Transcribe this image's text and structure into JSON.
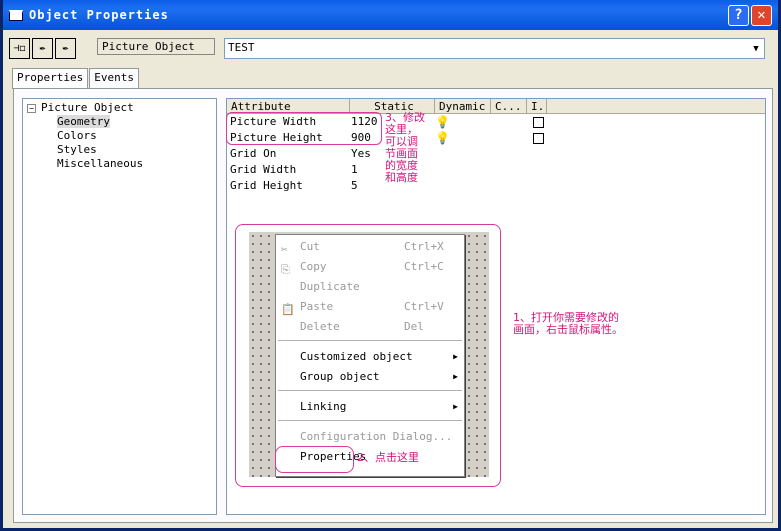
{
  "window": {
    "title": "Object Properties",
    "help_label": "?",
    "close_label": "✕"
  },
  "toolbar": {
    "buttons": [
      "pin-icon",
      "pick-icon",
      "pick-all-icon"
    ],
    "object_type": "Picture Object",
    "object_name": "TEST"
  },
  "tabs": [
    {
      "label": "Properties",
      "active": true
    },
    {
      "label": "Events",
      "active": false
    }
  ],
  "tree": {
    "root": "Picture Object",
    "expander": "−",
    "children": [
      "Geometry",
      "Colors",
      "Styles",
      "Miscellaneous"
    ],
    "selected": "Geometry"
  },
  "grid": {
    "columns": [
      "Attribute",
      "Static",
      "Dynamic",
      "C...",
      "I."
    ],
    "rows": [
      {
        "attribute": "Picture Width",
        "value": "1120",
        "dynamic": true,
        "checkbox": true
      },
      {
        "attribute": "Picture Height",
        "value": "900",
        "dynamic": true,
        "checkbox": true
      },
      {
        "attribute": "Grid On",
        "value": "Yes",
        "dynamic": false,
        "checkbox": false
      },
      {
        "attribute": "Grid Width",
        "value": "1",
        "dynamic": false,
        "checkbox": false
      },
      {
        "attribute": "Grid Height",
        "value": "5",
        "dynamic": false,
        "checkbox": false
      }
    ]
  },
  "notes": {
    "step1": [
      "1、打开你需要修改的",
      "画面，右击鼠标属性。"
    ],
    "step2": "2、点击这里",
    "step3": [
      "3、修改",
      "这里，",
      "可以调",
      "节画面",
      "的宽度",
      "和高度"
    ]
  },
  "context_menu": {
    "items": [
      {
        "label": "Cut",
        "shortcut": "Ctrl+X",
        "disabled": true,
        "icon": "✂"
      },
      {
        "label": "Copy",
        "shortcut": "Ctrl+C",
        "disabled": true,
        "icon": "⎘"
      },
      {
        "label": "Duplicate",
        "shortcut": "",
        "disabled": true
      },
      {
        "label": "Paste",
        "shortcut": "Ctrl+V",
        "disabled": true,
        "icon": "📋"
      },
      {
        "label": "Delete",
        "shortcut": "Del",
        "disabled": true
      },
      {
        "label": "Customized object",
        "shortcut": "",
        "disabled": false,
        "submenu": true
      },
      {
        "label": "Group object",
        "shortcut": "",
        "disabled": false,
        "submenu": true
      },
      {
        "label": "Linking",
        "shortcut": "",
        "disabled": false,
        "submenu": true
      },
      {
        "label": "Configuration Dialog...",
        "shortcut": "",
        "disabled": true
      },
      {
        "label": "Properties",
        "shortcut": "",
        "disabled": false
      }
    ]
  },
  "colors": {
    "annotation": "#d4157b",
    "titlebar": "#0a5ee8"
  }
}
